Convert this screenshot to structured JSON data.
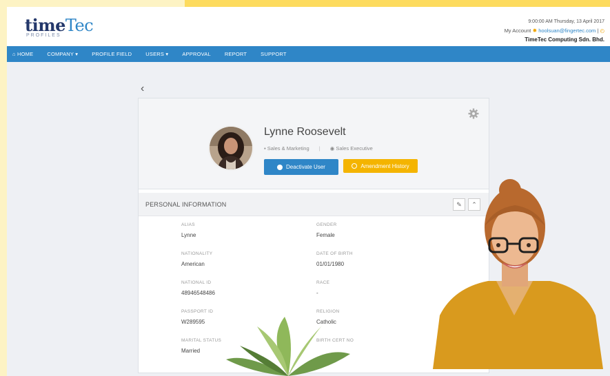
{
  "header": {
    "logo_main": "time",
    "logo_tec": "Tec",
    "logo_sub": "PROFILES",
    "datetime": "9:00:00 AM Thursday, 13 April 2017",
    "account_label": "My Account",
    "email": "hoolsuan@fingertec.com",
    "separator": "|",
    "company": "TimeTec Computing Sdn. Bhd."
  },
  "nav": {
    "items": [
      {
        "label": "HOME",
        "icon": "home-icon"
      },
      {
        "label": "COMPANY ▾"
      },
      {
        "label": "PROFILE FIELD"
      },
      {
        "label": "USERS ▾"
      },
      {
        "label": "APPROVAL"
      },
      {
        "label": "REPORT"
      },
      {
        "label": "SUPPORT"
      }
    ]
  },
  "back": "‹",
  "profile": {
    "name": "Lynne Roosevelt",
    "department": "Sales & Marketing",
    "position": "Sales Executive",
    "meta_sep": "|",
    "deactivate_label": "Deactivate User",
    "history_label": "Amendment History"
  },
  "section": {
    "title": "PERSONAL INFORMATION"
  },
  "fields": [
    {
      "label": "ALIAS",
      "value": "Lynne"
    },
    {
      "label": "GENDER",
      "value": "Female"
    },
    {
      "label": "NATIONALITY",
      "value": "American"
    },
    {
      "label": "DATE OF BIRTH",
      "value": "01/01/1980"
    },
    {
      "label": "NATIONAL ID",
      "value": "48946548486"
    },
    {
      "label": "RACE",
      "value": "-"
    },
    {
      "label": "PASSPORT ID",
      "value": "W289595"
    },
    {
      "label": "RELIGION",
      "value": "Catholic"
    },
    {
      "label": "MARITAL STATUS",
      "value": "Married"
    },
    {
      "label": "BIRTH CERT NO",
      "value": ""
    }
  ],
  "colors": {
    "brand_blue": "#2f86c7",
    "accent_yellow": "#f4b400",
    "navy": "#24386b"
  }
}
